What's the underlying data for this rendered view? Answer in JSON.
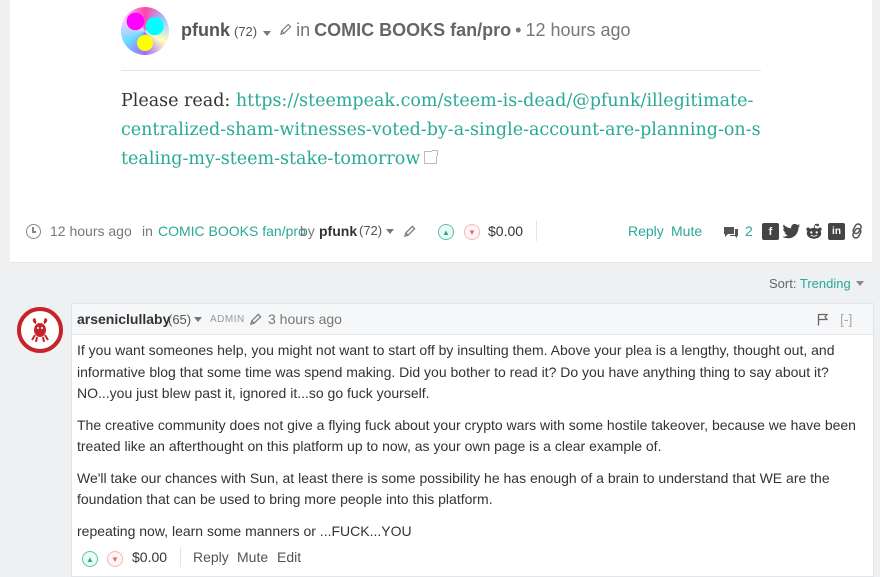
{
  "post": {
    "author": "pfunk",
    "reputation": "(72)",
    "in_label": "in",
    "community": "COMIC BOOKS fan/pro",
    "separator": "•",
    "time": "12 hours ago",
    "body_prefix": "Please read:",
    "link": "https://steempeak.com/steem-is-dead/@pfunk/illegitimate-centralized-sham-witnesses-voted-by-a-single-account-are-planning-on-stealing-my-steem-stake-tomorrow"
  },
  "post_footer": {
    "time": "12 hours ago",
    "in_label": "in",
    "community": "COMIC BOOKS fan/pro",
    "by_label": "by",
    "author": "pfunk",
    "reputation": "(72)",
    "payout": "$0.00",
    "reply_label": "Reply",
    "mute_label": "Mute",
    "comment_count": "2",
    "share_icons": [
      "facebook-icon",
      "twitter-icon",
      "reddit-icon",
      "linkedin-icon",
      "link-icon"
    ]
  },
  "sort": {
    "label": "Sort:",
    "value": "Trending"
  },
  "reply": {
    "author": "arseniclullaby",
    "reputation": "(65)",
    "badge": "ADMIN",
    "time": "3 hours ago",
    "collapse_label": "[-]",
    "paragraphs": [
      "If you want someones help, you might not want to start off by insulting them. Above your plea is a lengthy, thought out, and informative blog that some time was spend making. Did you bother to read it? Do you have anything thing to say about it? NO...you just blew past it, ignored it...so go fuck yourself.",
      "The creative community does not give a flying fuck about your crypto wars with some hostile takeover, because we have been treated like an afterthought on this platform up to now, as your own page is a clear example of.",
      "We'll take our chances with Sun, at least there is some possibility he has enough of a brain to understand that WE are the foundation that can be used to bring more people into this platform.",
      "repeating now, learn some manners or ...FUCK...YOU"
    ],
    "payout": "$0.00",
    "reply_label": "Reply",
    "mute_label": "Mute",
    "edit_label": "Edit"
  },
  "colors": {
    "accent": "#2aa996",
    "background": "#eef0f2",
    "avatar_ring": "#c6242b"
  }
}
